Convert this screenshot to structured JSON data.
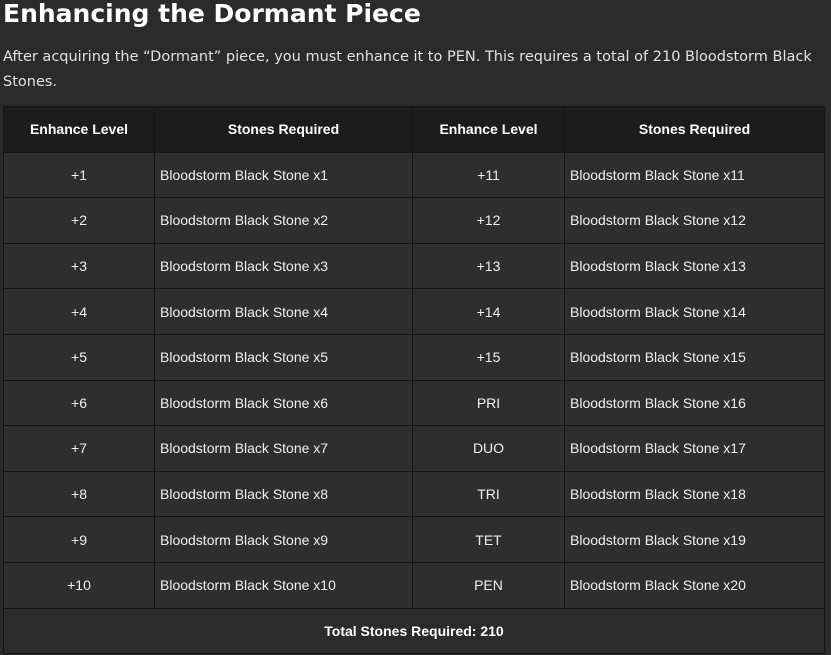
{
  "title": "Enhancing the Dormant Piece",
  "intro": "After acquiring the “Dormant” piece, you must enhance it to PEN. This requires a total of 210 Bloodstorm Black Stones.",
  "table": {
    "headers": [
      "Enhance Level",
      "Stones Required",
      "Enhance Level",
      "Stones Required"
    ],
    "rows": [
      {
        "level_a": "+1",
        "stones_a": "Bloodstorm Black Stone x1",
        "level_b": "+11",
        "stones_b": "Bloodstorm Black Stone x11"
      },
      {
        "level_a": "+2",
        "stones_a": "Bloodstorm Black Stone x2",
        "level_b": "+12",
        "stones_b": "Bloodstorm Black Stone x12"
      },
      {
        "level_a": "+3",
        "stones_a": "Bloodstorm Black Stone x3",
        "level_b": "+13",
        "stones_b": "Bloodstorm Black Stone x13"
      },
      {
        "level_a": "+4",
        "stones_a": "Bloodstorm Black Stone x4",
        "level_b": "+14",
        "stones_b": "Bloodstorm Black Stone x14"
      },
      {
        "level_a": "+5",
        "stones_a": "Bloodstorm Black Stone x5",
        "level_b": "+15",
        "stones_b": "Bloodstorm Black Stone x15"
      },
      {
        "level_a": "+6",
        "stones_a": "Bloodstorm Black Stone x6",
        "level_b": "PRI",
        "stones_b": "Bloodstorm Black Stone x16"
      },
      {
        "level_a": "+7",
        "stones_a": "Bloodstorm Black Stone x7",
        "level_b": "DUO",
        "stones_b": "Bloodstorm Black Stone x17"
      },
      {
        "level_a": "+8",
        "stones_a": "Bloodstorm Black Stone x8",
        "level_b": "TRI",
        "stones_b": "Bloodstorm Black Stone x18"
      },
      {
        "level_a": "+9",
        "stones_a": "Bloodstorm Black Stone x9",
        "level_b": "TET",
        "stones_b": "Bloodstorm Black Stone x19"
      },
      {
        "level_a": "+10",
        "stones_a": "Bloodstorm Black Stone x10",
        "level_b": "PEN",
        "stones_b": "Bloodstorm Black Stone x20"
      }
    ],
    "total": "Total Stones Required: 210"
  }
}
